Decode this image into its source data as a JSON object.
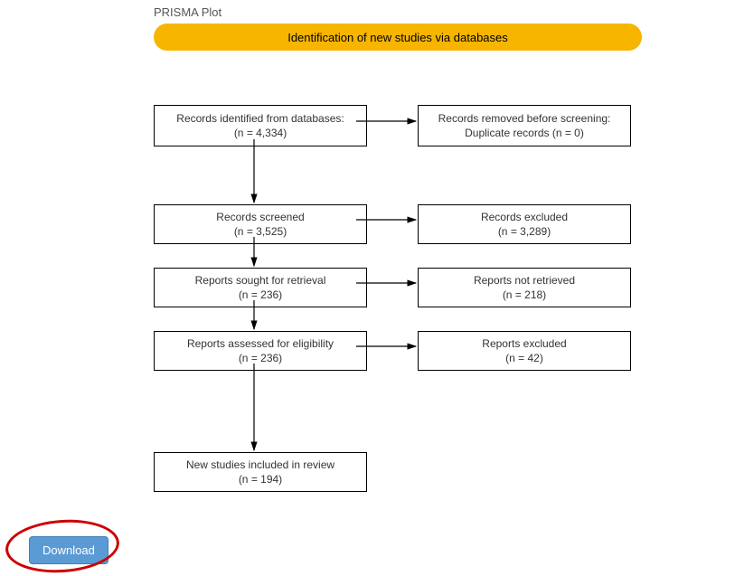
{
  "title": "PRISMA Plot",
  "banner": "Identification of new studies via databases",
  "boxes": {
    "identified": {
      "l1": "Records identified from databases:",
      "l2": "(n = 4,334)"
    },
    "removed": {
      "l1": "Records removed before screening:",
      "l2": "Duplicate records (n = 0)"
    },
    "screened": {
      "l1": "Records screened",
      "l2": "(n = 3,525)"
    },
    "excluded": {
      "l1": "Records excluded",
      "l2": "(n = 3,289)"
    },
    "sought": {
      "l1": "Reports sought for retrieval",
      "l2": "(n = 236)"
    },
    "notretrieved": {
      "l1": "Reports not retrieved",
      "l2": "(n = 218)"
    },
    "assessed": {
      "l1": "Reports assessed for eligibility",
      "l2": "(n = 236)"
    },
    "repexcluded": {
      "l1": "Reports excluded",
      "l2": "(n = 42)"
    },
    "included": {
      "l1": "New studies included in review",
      "l2": "(n = 194)"
    }
  },
  "download": "Download"
}
